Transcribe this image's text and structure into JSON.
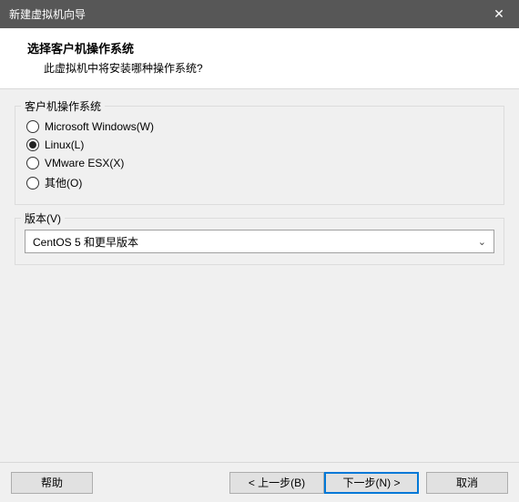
{
  "titlebar": {
    "title": "新建虚拟机向导"
  },
  "header": {
    "title": "选择客户机操作系统",
    "subtitle": "此虚拟机中将安装哪种操作系统?"
  },
  "os_group": {
    "legend": "客户机操作系统",
    "options": [
      {
        "label": "Microsoft Windows(W)",
        "selected": false
      },
      {
        "label": "Linux(L)",
        "selected": true
      },
      {
        "label": "VMware ESX(X)",
        "selected": false
      },
      {
        "label": "其他(O)",
        "selected": false
      }
    ]
  },
  "version_group": {
    "legend": "版本(V)",
    "selected": "CentOS 5 和更早版本"
  },
  "footer": {
    "help": "帮助",
    "back": "< 上一步(B)",
    "next": "下一步(N) >",
    "cancel": "取消"
  }
}
